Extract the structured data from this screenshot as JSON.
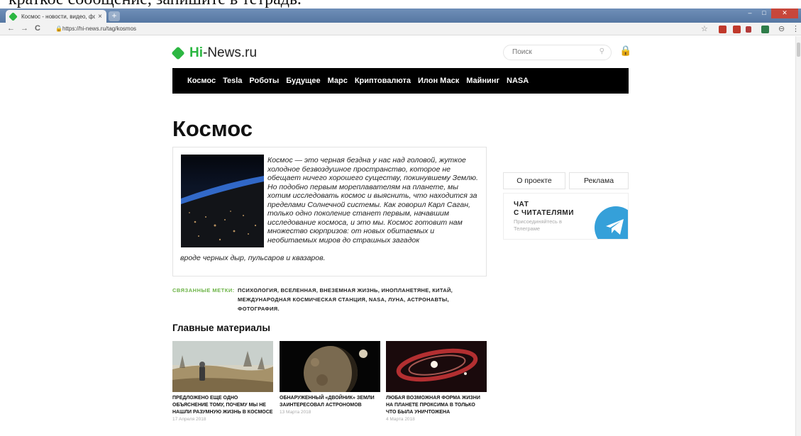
{
  "document_fragment": "краткое сообщение, запишите в тетрадь.",
  "browser": {
    "tab_title": "Космос - новости, видео, фото",
    "tab_close": "×",
    "new_tab": "+",
    "window_buttons": [
      "–",
      "□",
      "✕"
    ],
    "url": "https://hi-news.ru/tag/kosmos",
    "nav": {
      "back": "←",
      "forward": "→",
      "reload": "C"
    }
  },
  "site": {
    "logo_prefix": "Hi",
    "logo_suffix": "-News.ru",
    "search_placeholder": "Поиск",
    "menu": [
      "Космос",
      "Tesla",
      "Роботы",
      "Будущее",
      "Марс",
      "Криптовалюта",
      "Илон Маск",
      "Майнинг",
      "NASA"
    ]
  },
  "page": {
    "title": "Космос",
    "intro_main": "Космос — это черная бездна у нас над головой, жуткое холодное безвоздушное пространство, которое не обещает ничего хорошего существу, покинувшему Землю. Но подобно первым мореплавателям на планете, мы хотим исследовать космос и выяснить, что находится за пределами Солнечной системы. Как говорил Карл Саган, только одно поколение станет первым, начавшим исследование космоса, и это мы. Космос готовит нам множество сюрпризов: от новых обитаемых и необитаемых миров до страшных загадок",
    "intro_tail": "вроде черных дыр, пульсаров и квазаров.",
    "tags_label": "СВЯЗАННЫЕ МЕТКИ:",
    "tags_text": "ПСИХОЛОГИЯ, ВСЕЛЕННАЯ, ВНЕЗЕМНАЯ ЖИЗНЬ, ИНОПЛАНЕТЯНЕ, КИТАЙ, МЕЖДУНАРОДНАЯ КОСМИЧЕСКАЯ СТАНЦИЯ, NASA, ЛУНА, АСТРОНАВТЫ, ФОТОГРАФИЯ.",
    "section_title": "Главные материалы"
  },
  "sidebar": {
    "about": "О проекте",
    "ads": "Реклама",
    "chat_title_1": "ЧАТ",
    "chat_title_2": "С ЧИТАТЕЛЯМИ",
    "chat_sub": "Присоединяйтесь в Телеграме"
  },
  "cards": [
    {
      "title": "Предложено еще одно объяснение тому, почему мы не нашли разумную жизнь в космосе",
      "date": "17 Апреля 2018"
    },
    {
      "title": "Обнаруженный «двойник» Земли заинтересовал астрономов",
      "date": "13 Марта 2018"
    },
    {
      "title": "Любая возможная форма жизни на планете Проксима в только что была уничтожена",
      "date": "4 Марта 2018"
    }
  ],
  "colors": {
    "brand_green": "#2cb742",
    "tag_green": "#6cb346",
    "menu_bg": "#000000",
    "telegram_blue": "#35a0d9"
  }
}
